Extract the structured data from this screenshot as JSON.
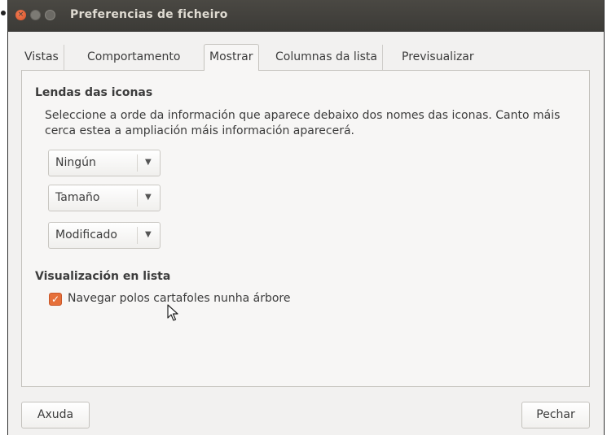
{
  "window": {
    "title": "Preferencias de ficheiro"
  },
  "tabs": [
    {
      "label": "Vistas",
      "active": false
    },
    {
      "label": "Comportamento",
      "active": false
    },
    {
      "label": "Mostrar",
      "active": true
    },
    {
      "label": "Columnas da lista",
      "active": false
    },
    {
      "label": "Previsualizar",
      "active": false
    }
  ],
  "icon_captions": {
    "heading": "Lendas das iconas",
    "description": "Seleccione a orde da información que aparece debaixo dos nomes das iconas. Canto máis cerca estea a ampliación máis información aparecerá.",
    "combos": [
      {
        "value": "Ningún"
      },
      {
        "value": "Tamaño"
      },
      {
        "value": "Modificado"
      }
    ]
  },
  "list_view": {
    "heading": "Visualización en lista",
    "checkbox_label": "Navegar polos cartafoles nunha árbore",
    "checkbox_checked": true
  },
  "footer": {
    "help_label": "Axuda",
    "close_label": "Pechar"
  },
  "colors": {
    "accent": "#e6703a",
    "titlebar": "#3c3b37",
    "window_bg": "#f2f1f0"
  },
  "icons": {
    "close": "close-icon",
    "minimize": "minimize-icon",
    "maximize": "maximize-icon",
    "dropdown": "chevron-down-icon",
    "cursor": "mouse-pointer-icon"
  }
}
